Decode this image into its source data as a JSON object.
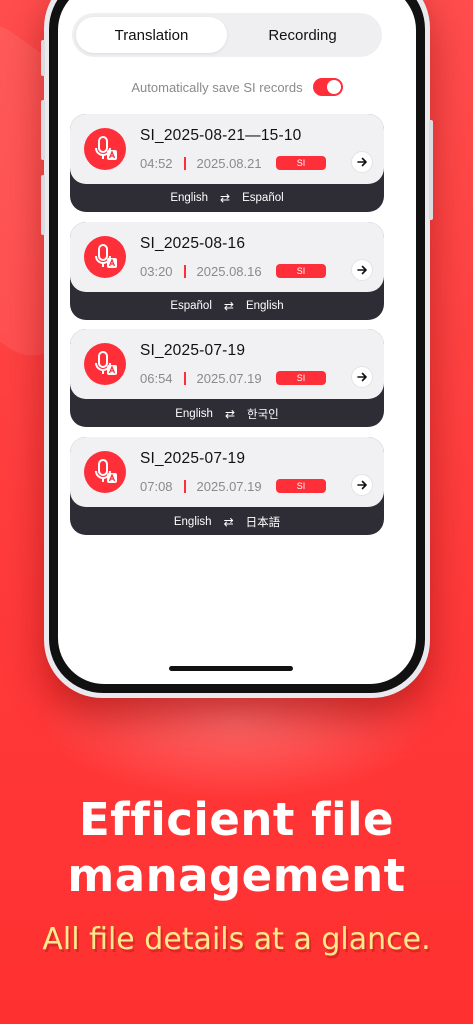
{
  "tabs": [
    {
      "label": "Translation",
      "active": true
    },
    {
      "label": "Recording",
      "active": false
    }
  ],
  "autosave": {
    "label": "Automatically save SI records",
    "enabled": true
  },
  "records": [
    {
      "title": "SI_2025-08-21—15-10",
      "duration": "04:52",
      "date": "2025.08.21",
      "badge": "SI",
      "from_lang": "English",
      "to_lang": "Español"
    },
    {
      "title": "SI_2025-08-16",
      "duration": "03:20",
      "date": "2025.08.16",
      "badge": "SI",
      "from_lang": "Español",
      "to_lang": "English"
    },
    {
      "title": "SI_2025-07-19",
      "duration": "06:54",
      "date": "2025.07.19",
      "badge": "SI",
      "from_lang": "English",
      "to_lang": "한국인"
    },
    {
      "title": "SI_2025-07-19",
      "duration": "07:08",
      "date": "2025.07.19",
      "badge": "SI",
      "from_lang": "English",
      "to_lang": "日本語"
    }
  ],
  "headline": {
    "line1": "Efficient file",
    "line2": "management"
  },
  "subheadline": "All file details at a glance.",
  "colors": {
    "accent": "#ff2f3a",
    "card_bottom": "#2e2d36",
    "background": "#ff3b3b",
    "subhead": "#ffe98c"
  },
  "icons": {
    "record": "mic-translate-icon",
    "open": "arrow-right-icon",
    "swap": "swap-arrows-icon"
  }
}
